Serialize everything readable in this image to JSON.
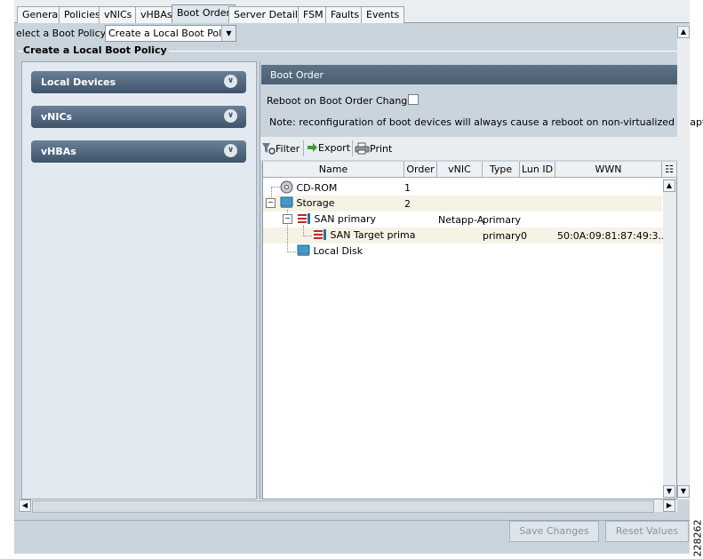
{
  "tabs": [
    {
      "label": "General"
    },
    {
      "label": "Policies"
    },
    {
      "label": "vNICs"
    },
    {
      "label": "vHBAs"
    },
    {
      "label": "Boot Order",
      "active": true
    },
    {
      "label": "Server Details"
    },
    {
      "label": "FSM"
    },
    {
      "label": "Faults"
    },
    {
      "label": "Events"
    }
  ],
  "select": {
    "label": "elect a Boot Policy:",
    "value": "Create a Local Boot Policy"
  },
  "section_title": "Create a Local Boot Policy",
  "accordion": [
    {
      "label": "Local Devices"
    },
    {
      "label": "vNICs"
    },
    {
      "label": "vHBAs"
    }
  ],
  "boot_order": {
    "header": "Boot Order",
    "reboot_label": "Reboot on Boot Order Change:",
    "reboot_checked": false,
    "note": "Note: reconfiguration of boot devices will always cause a reboot on non-virtualized adapters.",
    "toolbar": {
      "filter": "Filter",
      "export": "Export",
      "print": "Print"
    },
    "columns": [
      "Name",
      "Order",
      "vNIC",
      "Type",
      "Lun ID",
      "WWN"
    ],
    "rows": [
      {
        "name": "CD-ROM",
        "order": "1",
        "vnic": "",
        "type": "",
        "lun": "",
        "wwn": ""
      },
      {
        "name": "Storage",
        "order": "2",
        "vnic": "",
        "type": "",
        "lun": "",
        "wwn": ""
      },
      {
        "name": "SAN primary",
        "order": "",
        "vnic": "Netapp-A",
        "type": "primary",
        "lun": "",
        "wwn": ""
      },
      {
        "name": "SAN Target prima",
        "order": "",
        "vnic": "",
        "type": "primary",
        "lun": "0",
        "wwn": "50:0A:09:81:87:49:3..."
      },
      {
        "name": "Local Disk",
        "order": "",
        "vnic": "",
        "type": "",
        "lun": "",
        "wwn": ""
      }
    ]
  },
  "buttons": {
    "save": "Save Changes",
    "reset": "Reset Values"
  },
  "figure_id": "228262",
  "colors": {
    "panel": "#c9d4dd",
    "header": "#4a5f72",
    "accordion": "#3e546b"
  }
}
